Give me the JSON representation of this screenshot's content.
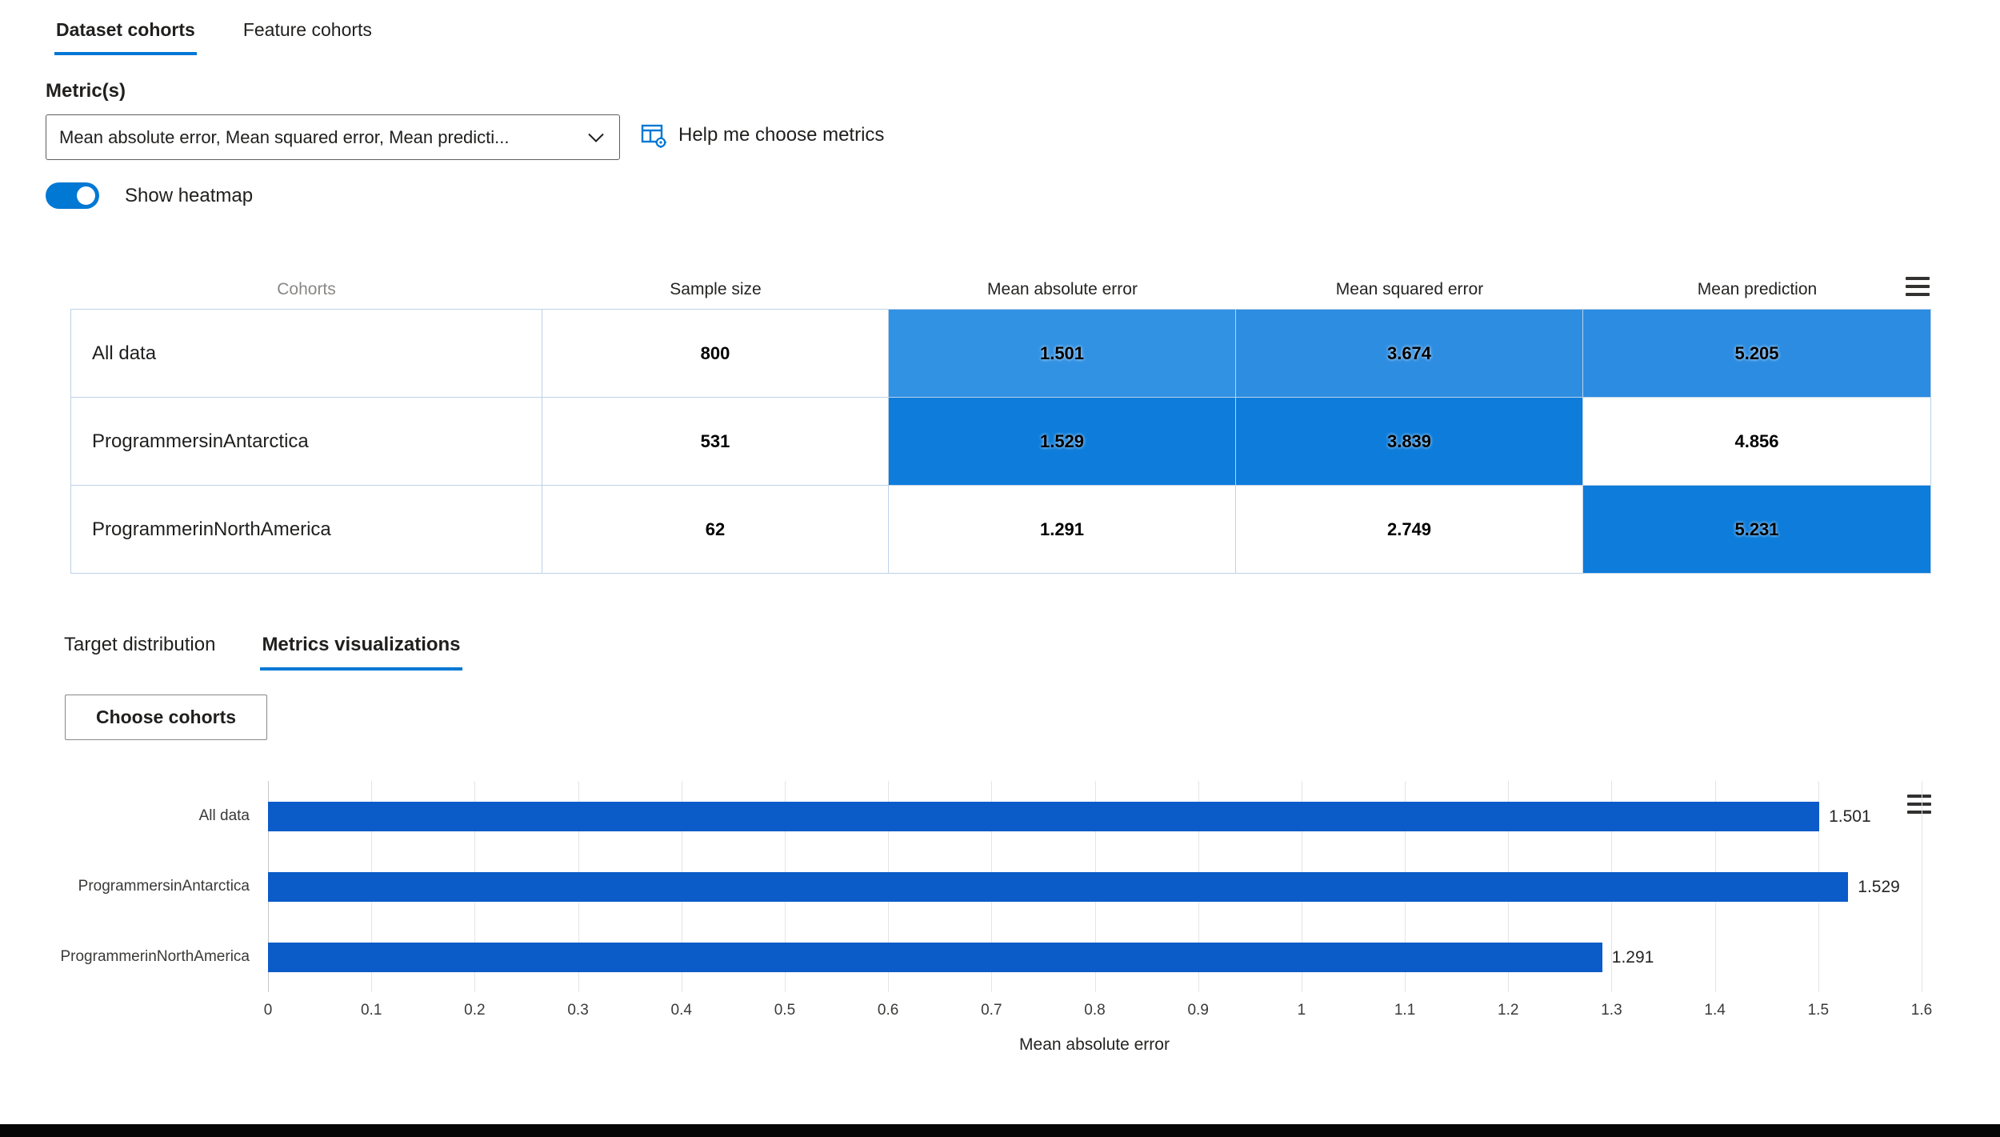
{
  "colors": {
    "accent": "#0078d4",
    "heatmap_mid": "#3191e3",
    "heatmap_strong": "#0d7cda",
    "bar": "#0b5bc9"
  },
  "tabs": [
    {
      "label": "Dataset cohorts",
      "active": true
    },
    {
      "label": "Feature cohorts",
      "active": false
    }
  ],
  "metrics": {
    "label": "Metric(s)",
    "dropdown_value": "Mean absolute error, Mean squared error, Mean predicti...",
    "help_label": "Help me choose metrics"
  },
  "heatmap_toggle": {
    "label": "Show heatmap",
    "state": "on"
  },
  "table": {
    "columns": [
      "Cohorts",
      "Sample size",
      "Mean absolute error",
      "Mean squared error",
      "Mean prediction"
    ],
    "rows": [
      {
        "cohort": "All data",
        "sample_size": "800",
        "cells": [
          {
            "value": "1.501",
            "bg": "#3191e3"
          },
          {
            "value": "3.674",
            "bg": "#2d8de1"
          },
          {
            "value": "5.205",
            "bg": "#2b8ce1"
          }
        ]
      },
      {
        "cohort": "ProgrammersinAntarctica",
        "sample_size": "531",
        "cells": [
          {
            "value": "1.529",
            "bg": "#0d7cda"
          },
          {
            "value": "3.839",
            "bg": "#0d7cda"
          },
          {
            "value": "4.856",
            "bg": "#ffffff"
          }
        ]
      },
      {
        "cohort": "ProgrammerinNorthAmerica",
        "sample_size": "62",
        "cells": [
          {
            "value": "1.291",
            "bg": "#ffffff"
          },
          {
            "value": "2.749",
            "bg": "#ffffff"
          },
          {
            "value": "5.231",
            "bg": "#0d7cda"
          }
        ]
      }
    ]
  },
  "sub_tabs": [
    {
      "label": "Target distribution",
      "active": false
    },
    {
      "label": "Metrics visualizations",
      "active": true
    }
  ],
  "choose_cohorts": {
    "label": "Choose cohorts"
  },
  "chart_data": {
    "type": "bar",
    "orientation": "horizontal",
    "title": "",
    "categories": [
      "All data",
      "ProgrammersinAntarctica",
      "ProgrammerinNorthAmerica"
    ],
    "values": [
      1.501,
      1.529,
      1.291
    ],
    "value_labels": [
      "1.501",
      "1.529",
      "1.291"
    ],
    "xlabel": "Mean absolute error",
    "ylabel": "",
    "xlim": [
      0,
      1.6
    ],
    "xtick_labels": [
      "0",
      "0.1",
      "0.2",
      "0.3",
      "0.4",
      "0.5",
      "0.6",
      "0.7",
      "0.8",
      "0.9",
      "1",
      "1.1",
      "1.2",
      "1.3",
      "1.4",
      "1.5",
      "1.6"
    ],
    "bar_color": "#0b5bc9",
    "grid": true,
    "legend": "none"
  }
}
